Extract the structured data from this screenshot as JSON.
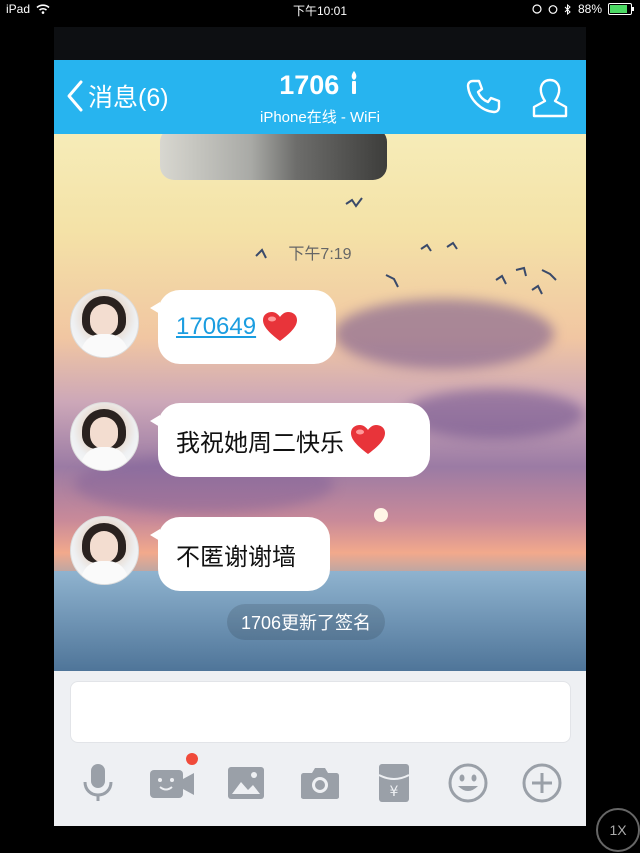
{
  "status_bar": {
    "device": "iPad",
    "time": "下午10:01",
    "battery": "88%"
  },
  "header": {
    "back_label": "消息(6)",
    "title": "1706",
    "subtitle": "iPhone在线 - WiFi"
  },
  "chat": {
    "timestamp": "下午7:19",
    "messages": [
      {
        "text": "170649",
        "type": "link",
        "emoji": "heart"
      },
      {
        "text": "我祝她周二快乐",
        "type": "text",
        "emoji": "heart"
      },
      {
        "text": "不匿谢谢墙",
        "type": "text",
        "emoji": ""
      }
    ],
    "system_notice": "1706更新了签名"
  },
  "input": {
    "placeholder": ""
  },
  "toolbar": {
    "icons": [
      "microphone-icon",
      "video-call-icon",
      "image-icon",
      "camera-icon",
      "red-packet-icon",
      "emoji-icon",
      "plus-icon"
    ]
  },
  "zoom_label": "1X",
  "colors": {
    "header": "#27b4ef",
    "link": "#1b9de0",
    "heart": "#e8343a",
    "notification_dot": "#f04a3a",
    "toolbar_icon": "#9aa0a8"
  }
}
